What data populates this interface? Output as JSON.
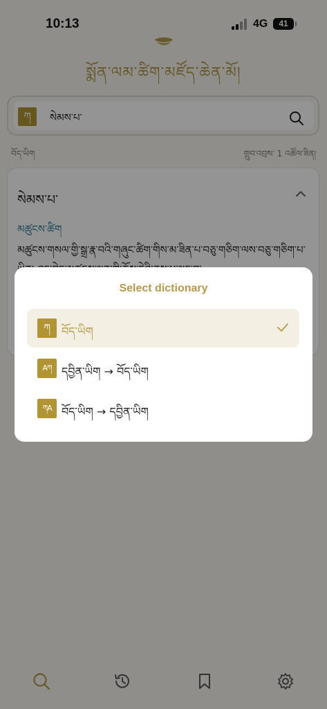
{
  "status": {
    "time": "10:13",
    "network": "4G",
    "battery": "41"
  },
  "header": {
    "title": "སྨོན་ལམ་ཚིག་མཛོད་ཆེན་མོ།"
  },
  "search": {
    "badge": "ཀ",
    "value": "སེམས་པ་"
  },
  "meta": {
    "language": "བོད་ཡིག",
    "duration": "གྲུབ་འབྲས་ 1 འཚོལ་ཟིན།"
  },
  "result": {
    "word": "སེམས་པ་",
    "source": "མཚུངས་ཚིག",
    "definition": "མཚུངས་གསལ་གྱི་སྒྲ་རྣ་བའི་གཞུང་ཚིག་གིས་མ་ཟིན་པ་བཅུ་གཅིག་ལས་བཅུ་གཅིག་པ་ཡིན། འདུ་བྱེད་མཚུངས་ལྡན་གྱི་ཆོས་དེའི་ནུས་པ་ལྡང་བ་"
  },
  "modal": {
    "title": "Select dictionary",
    "options": [
      {
        "badge": "ཀ",
        "label": "བོད་ཡིག",
        "selected": true
      },
      {
        "badge": "Aཀ",
        "label": "དབྱིན་ཡིག → བོད་ཡིག",
        "selected": false
      },
      {
        "badge": "ཀA",
        "label": "བོད་ཡིག → དབྱིན་ཡིག",
        "selected": false
      }
    ]
  },
  "nav": {
    "items": [
      {
        "icon": "search-icon",
        "active": true
      },
      {
        "icon": "history-icon",
        "active": false
      },
      {
        "icon": "bookmark-icon",
        "active": false
      },
      {
        "icon": "gear-icon",
        "active": false
      }
    ]
  },
  "colors": {
    "accent": "#b39a4a",
    "badge": "#b19434",
    "link": "#2f7d94",
    "background": "#f6f4ee"
  }
}
